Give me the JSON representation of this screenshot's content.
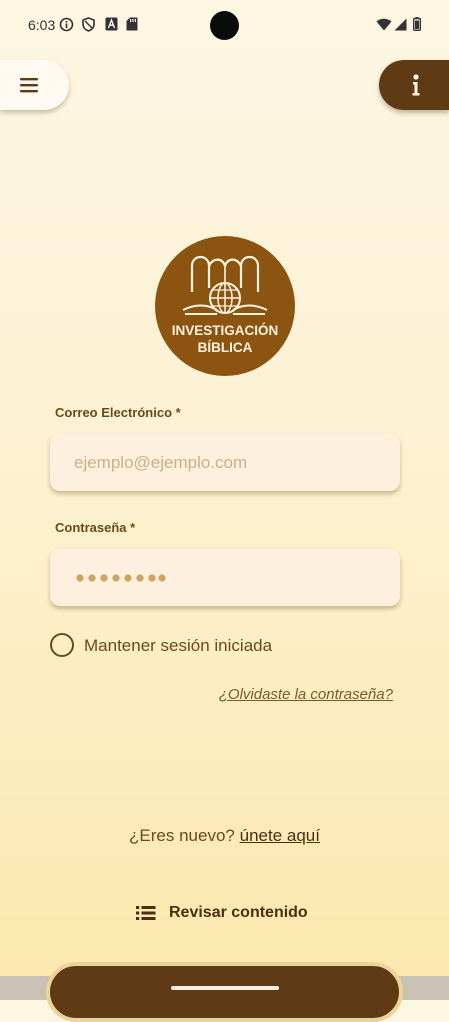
{
  "status_bar": {
    "time": "6:03",
    "left_icons": [
      "info-circle-icon",
      "shield-icon",
      "a-badge-icon",
      "sd-card-icon"
    ],
    "right_icons": [
      "wifi-icon",
      "signal-icon",
      "battery-icon"
    ]
  },
  "header": {
    "menu_icon": "hamburger-menu-icon",
    "info_icon": "info-icon"
  },
  "logo": {
    "line1": "INVESTIGACIÓN",
    "line2": "BÍBLICA"
  },
  "form": {
    "email_label": "Correo Electrónico *",
    "email_placeholder": "ejemplo@ejemplo.com",
    "email_value": "",
    "password_label": "Contraseña *",
    "password_mask": "••••••••",
    "remember_label": "Mantener sesión iniciada",
    "remember_checked": false,
    "forgot_link": "¿Olvidaste la contraseña?"
  },
  "register": {
    "prompt": "¿Eres nuevo?",
    "link": "únete aquí"
  },
  "review": {
    "icon": "list-icon",
    "label": "Revisar contenido"
  },
  "colors": {
    "primary_brown": "#5e3b14",
    "logo_brown": "#8b5410",
    "text_brown": "#6b4a1a",
    "input_bg": "#fdf0de",
    "placeholder": "#cbb08a",
    "password_dots": "#cfa460"
  }
}
